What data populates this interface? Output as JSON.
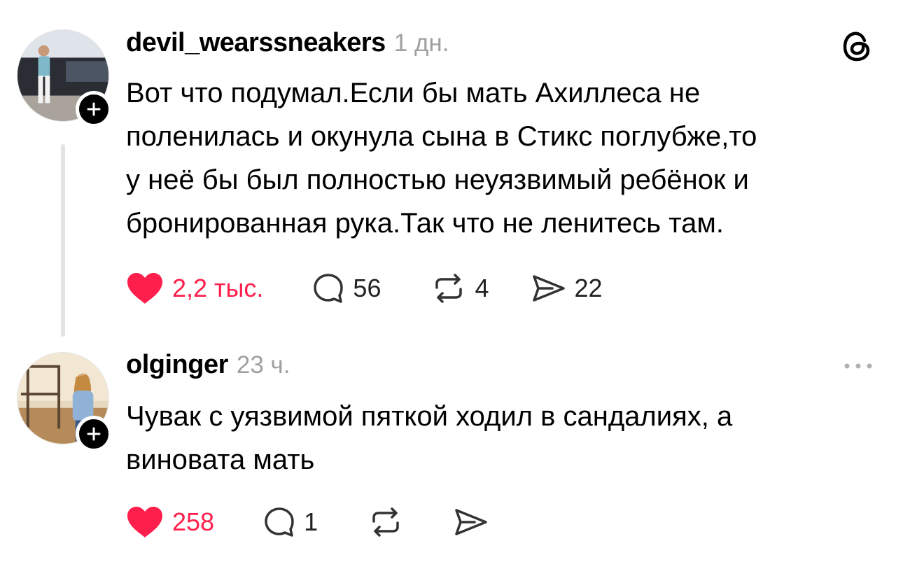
{
  "posts": [
    {
      "username": "devil_wearssneakers",
      "timestamp": "1 дн.",
      "text_lines": [
        "Вот что подумал.Если бы мать Ахиллеса не",
        "поленилась и окунула сына в Стикс поглубже,то",
        "у неё бы был полностью неуязвимый ребёнок и",
        "бронированная рука.Так что не ленитесь там."
      ],
      "likes": "2,2 тыс.",
      "replies": "56",
      "reposts": "4",
      "shares": "22",
      "corner_icon": "threads-logo-icon"
    },
    {
      "username": "olginger",
      "timestamp": "23 ч.",
      "text_lines": [
        "Чувак с уязвимой пяткой ходил в сандалиях, а",
        "виновата мать"
      ],
      "likes": "258",
      "replies": "1",
      "corner_icon": "more-options-icon"
    }
  ],
  "colors": {
    "like": "#ff1f4c",
    "muted": "#a0a0a0",
    "thread_line": "#e3e3e3"
  }
}
